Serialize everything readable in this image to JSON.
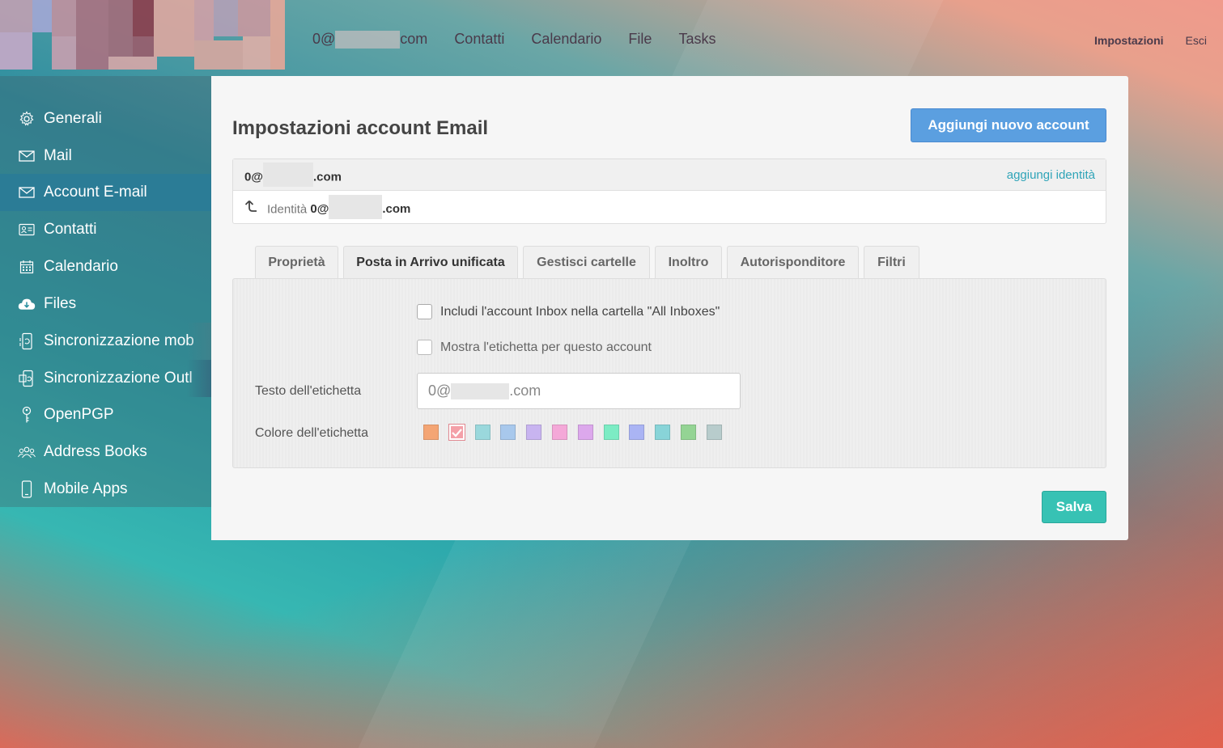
{
  "header": {
    "email_prefix": "0@",
    "email_suffix": "com",
    "nav": [
      "Contatti",
      "Calendario",
      "File",
      "Tasks"
    ],
    "settings_label": "Impostazioni",
    "logout_label": "Esci"
  },
  "sidebar": {
    "items": [
      {
        "label": "Generali",
        "icon": "gear-icon"
      },
      {
        "label": "Mail",
        "icon": "envelope-icon"
      },
      {
        "label": "Account E-mail",
        "icon": "envelope-icon",
        "active": true
      },
      {
        "label": "Contatti",
        "icon": "contact-card-icon"
      },
      {
        "label": "Calendario",
        "icon": "calendar-icon"
      },
      {
        "label": "Files",
        "icon": "cloud-download-icon"
      },
      {
        "label": "Sincronizzazione mob",
        "icon": "mobile-sync-icon"
      },
      {
        "label": "Sincronizzazione Outl",
        "icon": "outlook-sync-icon"
      },
      {
        "label": "OpenPGP",
        "icon": "key-icon"
      },
      {
        "label": "Address Books",
        "icon": "people-icon"
      },
      {
        "label": "Mobile Apps",
        "icon": "phone-icon"
      }
    ]
  },
  "main": {
    "title": "Impostazioni account Email",
    "add_account_label": "Aggiungi nuovo account",
    "account": {
      "name_prefix": "0@",
      "name_suffix": ".com",
      "add_identity_label": "aggiungi identità",
      "identity_label": "Identità",
      "identity_prefix": "0@",
      "identity_suffix": ".com"
    },
    "tabs": [
      {
        "label": "Proprietà"
      },
      {
        "label": "Posta in Arrivo unificata",
        "active": true
      },
      {
        "label": "Gestisci cartelle"
      },
      {
        "label": "Inoltro"
      },
      {
        "label": "Autorisponditore"
      },
      {
        "label": "Filtri"
      }
    ],
    "unified_inbox": {
      "include_label": "Includi l'account Inbox nella cartella \"All Inboxes\"",
      "show_label_label": "Mostra l'etichetta per questo account",
      "label_text_label": "Testo dell'etichetta",
      "label_text_value_prefix": "0@",
      "label_text_value_suffix": ".com",
      "label_color_label": "Colore dell'etichetta",
      "colors": [
        "#f4a574",
        "#f4a0a8",
        "#9ad8dc",
        "#a8c8ec",
        "#c8b4f0",
        "#f4a8d8",
        "#dca8ec",
        "#7cecc4",
        "#aab4f4",
        "#88d4d8",
        "#94d494",
        "#b8cccc"
      ],
      "selected_color_index": 1
    },
    "save_label": "Salva"
  }
}
